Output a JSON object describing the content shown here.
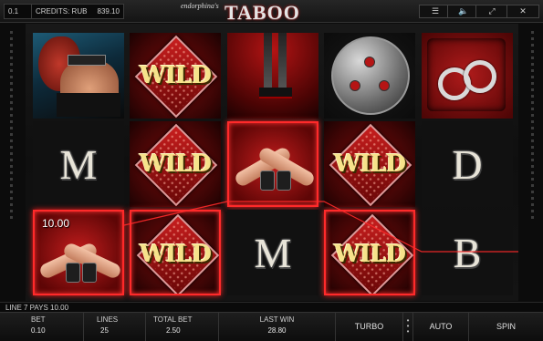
{
  "header": {
    "line_number": "0.1",
    "credits_label": "CREDITS: RUB",
    "credits_value": "839.10",
    "brand_small": "endorphina's",
    "brand_title": "TABOO",
    "icons": [
      "menu-icon",
      "sound-icon",
      "fullscreen-icon",
      "close-icon"
    ],
    "menu_glyph": "☰",
    "sound_glyph": "🔈",
    "fullscreen_glyph": "⤢",
    "close_glyph": "✕"
  },
  "reels": {
    "grid": [
      [
        "woman-portrait",
        "wild",
        "heels",
        "bdsm-triskelion",
        "handcuffs"
      ],
      [
        "M",
        "wild",
        "tied-hands",
        "wild",
        "D"
      ],
      [
        "tied-hands",
        "wild",
        "M",
        "wild",
        "B"
      ]
    ],
    "letters": {
      "r2c1": "M",
      "r3c3": "M",
      "r2c5": "D",
      "r3c5": "B"
    },
    "wild_label": "WILD",
    "win_amount": "10.00",
    "winning_positions": [
      "r3c1",
      "r3c2",
      "r2c3",
      "r3c4"
    ],
    "payline_color": "#ff2a2a"
  },
  "info": {
    "line_pays": "LINE 7 PAYS 10.00"
  },
  "bottom": {
    "bet_label": "BET",
    "bet_value": "0.10",
    "lines_label": "LINES",
    "lines_value": "25",
    "total_bet_label": "TOTAL BET",
    "total_bet_value": "2.50",
    "last_win_label": "LAST WIN",
    "last_win_value": "28.80",
    "turbo_label": "TURBO",
    "auto_label": "AUTO",
    "spin_label": "SPIN"
  },
  "colors": {
    "accent": "#ff2a2a",
    "wild_gold": "#f6e28a",
    "panel": "#141414"
  }
}
